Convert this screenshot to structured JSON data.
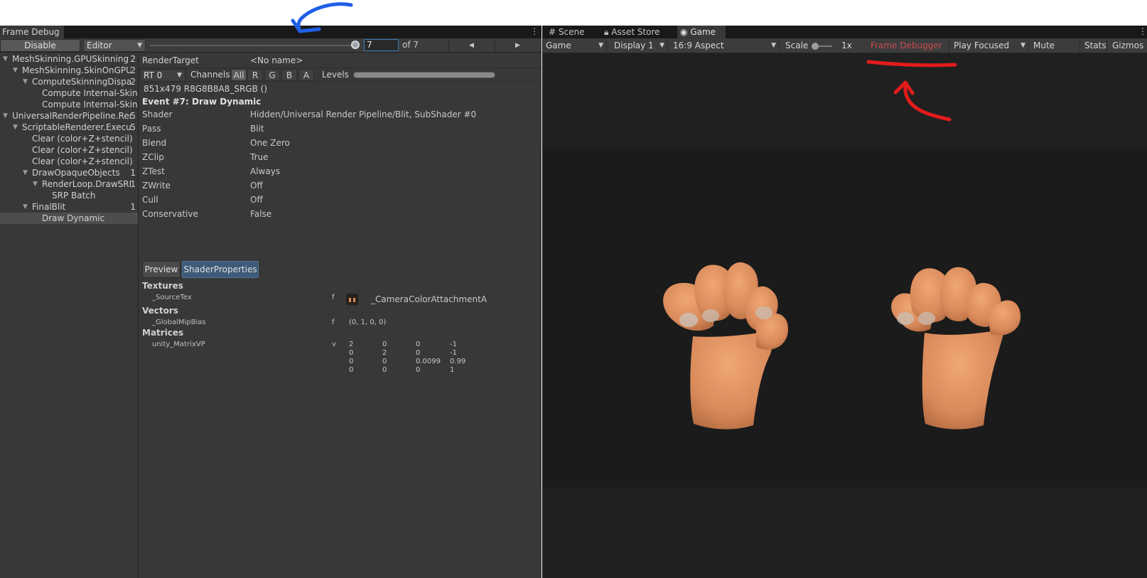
{
  "frame_debugger": {
    "tab_title": "Frame Debug",
    "menu_icon": "kebab-menu-icon",
    "toolbar": {
      "disable_label": "Disable",
      "target_dropdown": "Editor",
      "event_index": "7",
      "event_total": "of 7",
      "prev_icon": "triangle-left-icon",
      "next_icon": "triangle-right-icon"
    },
    "tree": [
      {
        "label": "MeshSkinning.GPUSkinning",
        "count": "2",
        "depth": 0,
        "expanded": true
      },
      {
        "label": "MeshSkinning.SkinOnGPU",
        "count": "2",
        "depth": 1,
        "expanded": true
      },
      {
        "label": "ComputeSkinningDispatc",
        "count": "2",
        "depth": 2,
        "expanded": true
      },
      {
        "label": "Compute Internal-Skinnir",
        "count": "",
        "depth": 3,
        "expanded": null
      },
      {
        "label": "Compute Internal-Skinnir",
        "count": "",
        "depth": 3,
        "expanded": null
      },
      {
        "label": "UniversalRenderPipeline.Rend",
        "count": "5",
        "depth": 0,
        "expanded": true
      },
      {
        "label": "ScriptableRenderer.Execute",
        "count": "5",
        "depth": 1,
        "expanded": true
      },
      {
        "label": "Clear (color+Z+stencil)",
        "count": "",
        "depth": 2,
        "expanded": null
      },
      {
        "label": "Clear (color+Z+stencil)",
        "count": "",
        "depth": 2,
        "expanded": null
      },
      {
        "label": "Clear (color+Z+stencil)",
        "count": "",
        "depth": 2,
        "expanded": null
      },
      {
        "label": "DrawOpaqueObjects",
        "count": "1",
        "depth": 2,
        "expanded": true
      },
      {
        "label": "RenderLoop.DrawSRPE",
        "count": "1",
        "depth": 3,
        "expanded": true
      },
      {
        "label": "SRP Batch",
        "count": "",
        "depth": 4,
        "expanded": null
      },
      {
        "label": "FinalBlit",
        "count": "1",
        "depth": 2,
        "expanded": true
      },
      {
        "label": "Draw Dynamic",
        "count": "",
        "depth": 3,
        "expanded": null,
        "selected": true
      }
    ],
    "details": {
      "render_target_label": "RenderTarget",
      "render_target_value": "<No name>",
      "rt_dropdown": "RT 0",
      "channels_label": "Channels",
      "channels": [
        "All",
        "R",
        "G",
        "B",
        "A"
      ],
      "active_channel": "All",
      "levels_label": "Levels",
      "format": "851x479 R8G8B8A8_SRGB ()",
      "event_title": "Event #7: Draw Dynamic",
      "properties": [
        {
          "name": "Shader",
          "value": "Hidden/Universal Render Pipeline/Blit, SubShader #0"
        },
        {
          "name": "Pass",
          "value": "Blit"
        },
        {
          "name": "Blend",
          "value": "One Zero"
        },
        {
          "name": "ZClip",
          "value": "True"
        },
        {
          "name": "ZTest",
          "value": "Always"
        },
        {
          "name": "ZWrite",
          "value": "Off"
        },
        {
          "name": "Cull",
          "value": "Off"
        },
        {
          "name": "Conservative",
          "value": "False"
        }
      ],
      "tabs": [
        "Preview",
        "ShaderProperties"
      ],
      "active_tab": "ShaderProperties",
      "textures_header": "Textures",
      "texture": {
        "name": "_SourceTex",
        "stage": "f",
        "value": "_CameraColorAttachmentA"
      },
      "vectors_header": "Vectors",
      "vector": {
        "name": "_GlobalMipBias",
        "stage": "f",
        "value": "(0, 1, 0, 0)"
      },
      "matrices_header": "Matrices",
      "matrix": {
        "name": "unity_MatrixVP",
        "stage": "v",
        "rows": [
          [
            "2",
            "0",
            "0",
            "-1"
          ],
          [
            "0",
            "2",
            "0",
            "-1"
          ],
          [
            "0",
            "0",
            "0.0099",
            "0.99"
          ],
          [
            "0",
            "0",
            "0",
            "1"
          ]
        ]
      }
    }
  },
  "game_view": {
    "tabs": [
      {
        "label": "Scene",
        "icon": "grid-icon"
      },
      {
        "label": "Asset Store",
        "icon": "lock-icon"
      },
      {
        "label": "Game",
        "icon": "gamepad-icon",
        "active": true
      }
    ],
    "menu_icon": "kebab-menu-icon",
    "toolbar": {
      "mode_dropdown": "Game",
      "display_dropdown": "Display 1",
      "aspect_dropdown": "16:9 Aspect",
      "scale_label": "Scale",
      "scale_value": "1x",
      "frame_debugger_status": "Frame Debugger On",
      "play_mode_dropdown": "Play Focused",
      "mute_audio": "Mute Audio",
      "stats": "Stats",
      "gizmos": "Gizmos"
    },
    "scene_content": [
      "left-hand-fist",
      "right-hand-fist"
    ]
  },
  "colors": {
    "panel_bg": "#383838",
    "game_bg": "#202020",
    "selection_bg": "#4d4d4d",
    "active_tab_blue": "#3d5a78",
    "frame_debugger_on": "#c94b4b",
    "annotation_red": "#e31b1b",
    "annotation_blue": "#1f5fe6",
    "skin": "#d98a5a"
  }
}
